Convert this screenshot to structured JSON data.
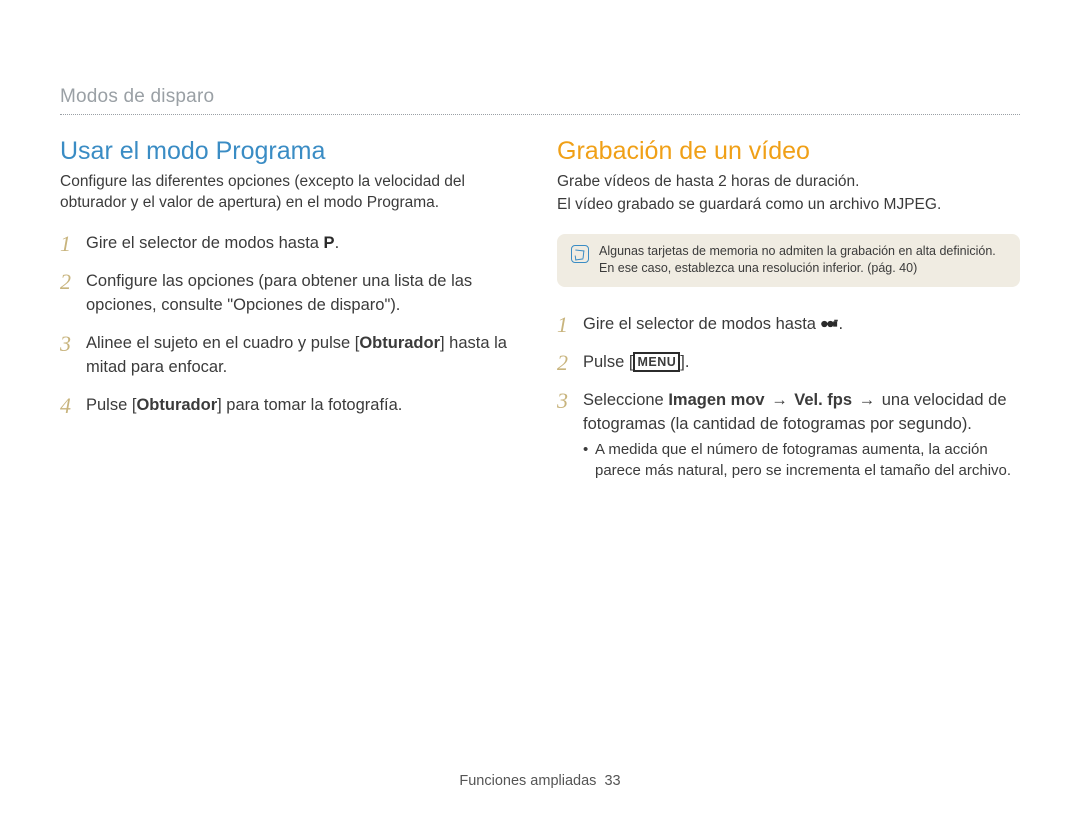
{
  "breadcrumb": "Modos de disparo",
  "left": {
    "title": "Usar el modo Programa",
    "intro": "Configure las diferentes opciones (excepto la velocidad del obturador y el valor de apertura) en el modo Programa.",
    "steps": [
      {
        "num": "1",
        "segments": [
          {
            "t": "Gire el selector de modos hasta "
          },
          {
            "icon": "p-icon"
          },
          {
            "t": "."
          }
        ]
      },
      {
        "num": "2",
        "segments": [
          {
            "t": "Configure las opciones (para obtener una lista de las opciones, consulte \"Opciones de disparo\")."
          }
        ]
      },
      {
        "num": "3",
        "segments": [
          {
            "t": "Alinee el sujeto en el cuadro y pulse ["
          },
          {
            "t": "Obturador",
            "bold": true
          },
          {
            "t": "] hasta la mitad para enfocar."
          }
        ]
      },
      {
        "num": "4",
        "segments": [
          {
            "t": "Pulse ["
          },
          {
            "t": "Obturador",
            "bold": true
          },
          {
            "t": "] para tomar la fotografía."
          }
        ]
      }
    ]
  },
  "right": {
    "title": "Grabación de un vídeo",
    "intro1": "Grabe vídeos de hasta 2 horas de duración.",
    "intro2": "El vídeo grabado se guardará como un archivo MJPEG.",
    "note": "Algunas tarjetas de memoria no admiten la grabación en alta definición. En ese caso, establezca una resolución inferior. (pág. 40)",
    "steps": [
      {
        "num": "1",
        "segments": [
          {
            "t": "Gire el selector de modos hasta "
          },
          {
            "icon": "movie-icon"
          },
          {
            "t": "."
          }
        ]
      },
      {
        "num": "2",
        "segments": [
          {
            "t": "Pulse ["
          },
          {
            "menu": "MENU"
          },
          {
            "t": "]."
          }
        ]
      },
      {
        "num": "3",
        "segments": [
          {
            "t": "Seleccione "
          },
          {
            "t": "Imagen mov",
            "bold": true
          },
          {
            "t": " "
          },
          {
            "arrow": "→"
          },
          {
            "t": " "
          },
          {
            "t": "Vel. fps",
            "bold": true
          },
          {
            "t": " "
          },
          {
            "arrow": "→"
          },
          {
            "t": " una velocidad de fotogramas (la cantidad de fotogramas por segundo)."
          }
        ],
        "sub": "A medida que el número de fotogramas aumenta, la acción parece más natural, pero se incrementa el tamaño del archivo."
      }
    ]
  },
  "footer": {
    "section": "Funciones ampliadas",
    "page": "33"
  }
}
